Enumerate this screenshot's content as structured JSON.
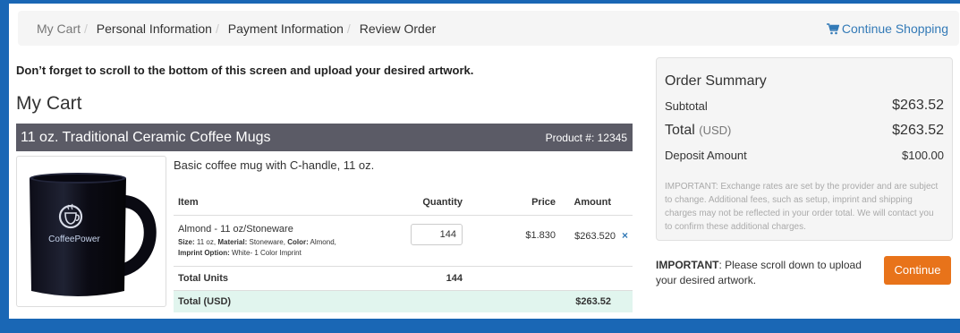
{
  "breadcrumb": [
    "My Cart",
    "Personal Information",
    "Payment Information",
    "Review Order"
  ],
  "continue_shopping": "Continue Shopping",
  "notice": "Don’t forget to scroll to the bottom of this screen and upload your desired artwork.",
  "heading": "My Cart",
  "product": {
    "name": "11 oz. Traditional Ceramic Coffee Mugs",
    "number": "Product #: 12345",
    "description": "Basic coffee mug with C-handle, 11 oz.",
    "image_brand_text": "CoffeePower"
  },
  "table": {
    "headers": {
      "item": "Item",
      "quantity": "Quantity",
      "price": "Price",
      "amount": "Amount"
    },
    "row": {
      "name": "Almond - 11 oz/Stoneware",
      "size_label": "Size:",
      "size": "11 oz,",
      "material_label": "Material:",
      "material": "Stoneware,",
      "color_label": "Color:",
      "color": "Almond,",
      "imprint_label": "Imprint Option:",
      "imprint": "White- 1 Color Imprint",
      "quantity": "144",
      "price": "$1.830",
      "amount": "$263.520",
      "remove_icon": "×"
    },
    "total_units_label": "Total Units",
    "total_units": "144",
    "total_label": "Total (USD)",
    "total": "$263.52"
  },
  "summary": {
    "title": "Order Summary",
    "subtotal_label": "Subtotal",
    "subtotal": "$263.52",
    "total_label": "Total",
    "total_currency": "(USD)",
    "total": "$263.52",
    "deposit_label": "Deposit Amount",
    "deposit": "$100.00",
    "note": "IMPORTANT: Exchange rates are set by the provider and are subject to change. Additional fees, such as setup, imprint and shipping charges may not be reflected in your order total. We will contact you to confirm these additional charges."
  },
  "important": {
    "label": "IMPORTANT",
    "text": ": Please scroll down to upload your desired artwork."
  },
  "continue_button": "Continue",
  "colors": {
    "accent": "#337ab7",
    "continue": "#e8731a",
    "product_bar": "#5b5b66",
    "total_row": "#e1f5ee",
    "background": "#1a67b5"
  }
}
